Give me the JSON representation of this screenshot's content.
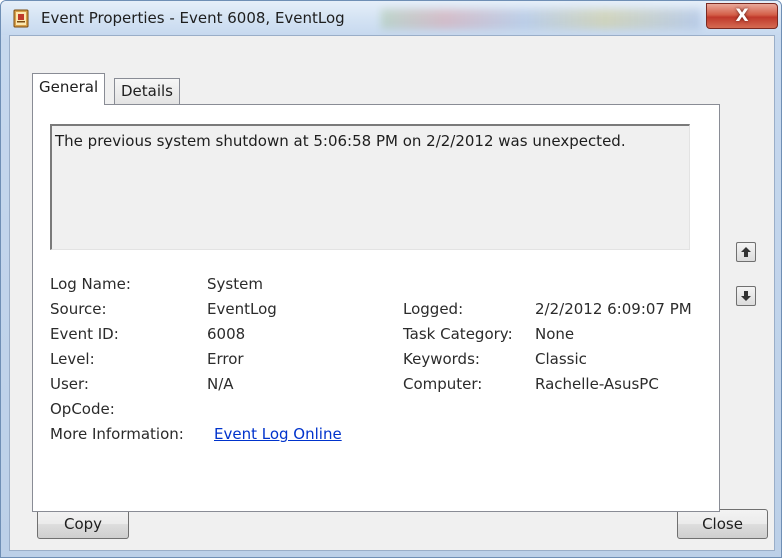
{
  "window": {
    "title": "Event Properties - Event 6008, EventLog",
    "close_glyph": "X",
    "icon": "event-log-icon"
  },
  "tabs": [
    {
      "label": "General",
      "active": true
    },
    {
      "label": "Details",
      "active": false
    }
  ],
  "description": "The previous system shutdown at 5:06:58 PM on 2/2/2012 was unexpected.",
  "fields": {
    "log_name": {
      "label": "Log Name:",
      "value": "System"
    },
    "source": {
      "label": "Source:",
      "value": "EventLog"
    },
    "event_id": {
      "label": "Event ID:",
      "value": "6008"
    },
    "level": {
      "label": "Level:",
      "value": "Error"
    },
    "user": {
      "label": "User:",
      "value": "N/A"
    },
    "opcode": {
      "label": "OpCode:",
      "value": ""
    },
    "more_info": {
      "label": "More Information:",
      "link": "Event Log Online "
    },
    "logged": {
      "label": "Logged:",
      "value": "2/2/2012 6:09:07 PM"
    },
    "task_category": {
      "label": "Task Category:",
      "value": "None"
    },
    "keywords": {
      "label": "Keywords:",
      "value": "Classic"
    },
    "computer": {
      "label": "Computer:",
      "value": "Rachelle-AsusPC"
    }
  },
  "buttons": {
    "copy": "Copy",
    "close": "Close"
  },
  "nav_icons": [
    "arrow-up-icon",
    "arrow-down-icon"
  ],
  "colors": {
    "link": "#0033cc",
    "close_button": "#c0392b",
    "frame": "#c6d8ee"
  }
}
